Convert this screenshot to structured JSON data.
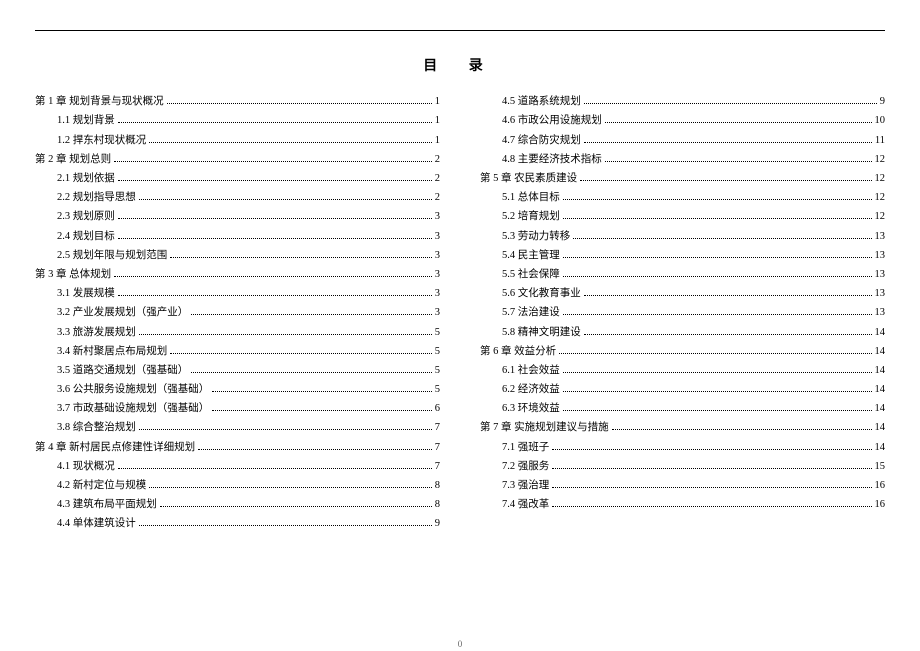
{
  "title": "目 录",
  "page_footer": "0",
  "left": [
    {
      "level": 1,
      "label": "第 1 章 规划背景与现状概况",
      "page": "1"
    },
    {
      "level": 2,
      "label": "1.1 规划背景",
      "page": "1"
    },
    {
      "level": 2,
      "label": "1.2 捍东村现状概况",
      "page": "1"
    },
    {
      "level": 1,
      "label": "第 2 章 规划总则",
      "page": "2"
    },
    {
      "level": 2,
      "label": "2.1 规划依据",
      "page": "2"
    },
    {
      "level": 2,
      "label": "2.2 规划指导思想",
      "page": "2"
    },
    {
      "level": 2,
      "label": "2.3 规划原则",
      "page": "3"
    },
    {
      "level": 2,
      "label": "2.4 规划目标",
      "page": "3"
    },
    {
      "level": 2,
      "label": "2.5 规划年限与规划范围",
      "page": "3"
    },
    {
      "level": 1,
      "label": "第 3 章 总体规划",
      "page": "3"
    },
    {
      "level": 2,
      "label": "3.1 发展规模",
      "page": "3"
    },
    {
      "level": 2,
      "label": "3.2 产业发展规划（强产业）",
      "page": "3"
    },
    {
      "level": 2,
      "label": "3.3 旅游发展规划",
      "page": "5"
    },
    {
      "level": 2,
      "label": "3.4 新村聚居点布局规划",
      "page": "5"
    },
    {
      "level": 2,
      "label": "3.5 道路交通规划（强基础）",
      "page": "5"
    },
    {
      "level": 2,
      "label": "3.6 公共服务设施规划（强基础）",
      "page": "5"
    },
    {
      "level": 2,
      "label": "3.7 市政基础设施规划（强基础）",
      "page": "6"
    },
    {
      "level": 2,
      "label": "3.8 综合整治规划",
      "page": "7"
    },
    {
      "level": 1,
      "label": "第 4 章 新村居民点修建性详细规划",
      "page": "7"
    },
    {
      "level": 2,
      "label": "4.1 现状概况",
      "page": "7"
    },
    {
      "level": 2,
      "label": "4.2 新村定位与规模",
      "page": "8"
    },
    {
      "level": 2,
      "label": "4.3 建筑布局平面规划",
      "page": "8"
    },
    {
      "level": 2,
      "label": "4.4 单体建筑设计",
      "page": "9"
    }
  ],
  "right": [
    {
      "level": 2,
      "label": "4.5 道路系统规划",
      "page": "9"
    },
    {
      "level": 2,
      "label": "4.6 市政公用设施规划",
      "page": "10"
    },
    {
      "level": 2,
      "label": "4.7 综合防灾规划",
      "page": "11"
    },
    {
      "level": 2,
      "label": "4.8 主要经济技术指标",
      "page": "12"
    },
    {
      "level": 1,
      "label": "第 5 章 农民素质建设",
      "page": "12"
    },
    {
      "level": 2,
      "label": "5.1 总体目标",
      "page": "12"
    },
    {
      "level": 2,
      "label": "5.2 培育规划",
      "page": "12"
    },
    {
      "level": 2,
      "label": "5.3 劳动力转移",
      "page": "13"
    },
    {
      "level": 2,
      "label": "5.4 民主管理",
      "page": "13"
    },
    {
      "level": 2,
      "label": "5.5 社会保障",
      "page": "13"
    },
    {
      "level": 2,
      "label": "5.6 文化教育事业",
      "page": "13"
    },
    {
      "level": 2,
      "label": "5.7 法治建设",
      "page": "13"
    },
    {
      "level": 2,
      "label": "5.8 精神文明建设",
      "page": "14"
    },
    {
      "level": 1,
      "label": "第 6 章 效益分析",
      "page": "14"
    },
    {
      "level": 2,
      "label": "6.1 社会效益",
      "page": "14"
    },
    {
      "level": 2,
      "label": "6.2 经济效益",
      "page": "14"
    },
    {
      "level": 2,
      "label": "6.3 环境效益",
      "page": "14"
    },
    {
      "level": 1,
      "label": "第 7 章 实施规划建议与措施",
      "page": "14"
    },
    {
      "level": 2,
      "label": "7.1 强班子",
      "page": "14"
    },
    {
      "level": 2,
      "label": "7.2 强服务",
      "page": "15"
    },
    {
      "level": 2,
      "label": "7.3 强治理",
      "page": "16"
    },
    {
      "level": 2,
      "label": "7.4 强改革",
      "page": "16"
    }
  ]
}
